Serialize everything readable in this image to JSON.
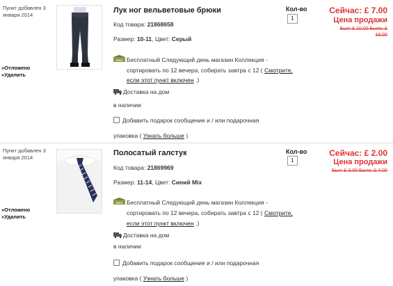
{
  "items": [
    {
      "added_date": "Пункт добавлен 3 января 2014",
      "actions": {
        "postpone": "»Отложено",
        "delete": "»Удалить"
      },
      "title": "Лук ног вельветовые брюки",
      "sku_label": "Код товара:",
      "sku": "21868658",
      "size_label": "Размер:",
      "size": "10-11",
      "color_label": ", Цвет:",
      "color": "Серый",
      "store_text_1": "Бесплатный Следующий день магазин Коллекция -",
      "store_text_2": "сортировать по 12 вечера, собирать завтра с 12 (",
      "store_link_1": "Смотрите,",
      "store_link_2": "если этот пункт включен",
      "store_close": ".)",
      "delivery": "Доставка на дом",
      "stock": "в наличии",
      "gift_text": "Добавить подарок сообщение и / или подарочная",
      "gift_text_2": "упаковка (",
      "gift_link": "Узнать больше",
      "gift_close": ")",
      "qty_label": "Кол-во",
      "qty": "1",
      "price_now": "Сейчас: £ 7.00",
      "price_sale": "Цена продажи",
      "price_was_1": "Был: £ 10.00 Было: £",
      "price_was_2": "16.00"
    },
    {
      "added_date": "Пункт добавлен 3 января 2014",
      "actions": {
        "postpone": "»Отложено",
        "delete": "»Удалить"
      },
      "title": "Полосатый галстук",
      "sku_label": "Код товара:",
      "sku": "21869969",
      "size_label": "Размер:",
      "size": "11-14",
      "color_label": ", Цвет:",
      "color": "Синий Mix",
      "store_text_1": "Бесплатный Следующий день магазин Коллекция -",
      "store_text_2": "сортировать по 12 вечера, собирать завтра с 12 (",
      "store_link_1": "Смотрите,",
      "store_link_2": "если этот пункт включен",
      "store_close": ".)",
      "delivery": "Доставка на дом",
      "stock": "в наличии",
      "gift_text": "Добавить подарок сообщение и / или подарочная",
      "gift_text_2": "упаковка (",
      "gift_link": "Узнать больше",
      "gift_close": ")",
      "qty_label": "Кол-во",
      "qty": "1",
      "price_now": "Сейчас: £ 2.00",
      "price_sale": "Цена продажи",
      "price_was_1": "Был: £ 3.00 Было: £ 4.00",
      "price_was_2": ""
    }
  ],
  "icons": {
    "store": "store-collection-icon",
    "delivery": "delivery-truck-icon"
  },
  "colors": {
    "price": "#dd3333",
    "separator": "#dcdcdc"
  }
}
